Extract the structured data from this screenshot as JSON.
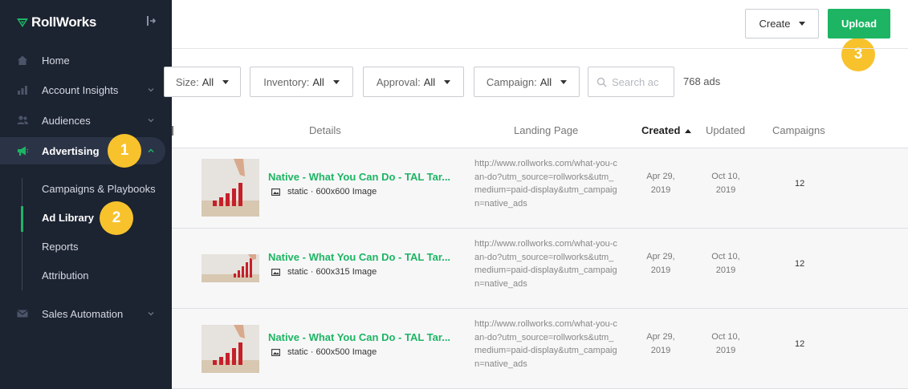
{
  "sidebar": {
    "logo_text": "RollWorks",
    "items": [
      {
        "label": "Home",
        "icon": "home-icon"
      },
      {
        "label": "Account Insights",
        "icon": "chart-icon"
      },
      {
        "label": "Audiences",
        "icon": "users-icon"
      },
      {
        "label": "Advertising",
        "icon": "megaphone-icon"
      },
      {
        "label": "Sales Automation",
        "icon": "mail-icon"
      }
    ],
    "sub_items": [
      "Campaigns & Playbooks",
      "Ad Library",
      "Reports",
      "Attribution"
    ]
  },
  "badges": [
    "1",
    "2",
    "3"
  ],
  "toolbar": {
    "create_label": "Create",
    "upload_label": "Upload"
  },
  "filters": {
    "size": {
      "label": "Size:",
      "value": "All"
    },
    "inventory": {
      "label": "Inventory:",
      "value": "All"
    },
    "approval": {
      "label": "Approval:",
      "value": "All"
    },
    "campaign": {
      "label": "Campaign:",
      "value": "All"
    },
    "search_placeholder": "Search ac",
    "count": "768 ads"
  },
  "table": {
    "headers": {
      "details": "Details",
      "landing": "Landing Page",
      "created": "Created",
      "updated": "Updated",
      "campaigns": "Campaigns"
    },
    "rows": [
      {
        "title": "Native - What You Can Do - TAL Tar...",
        "meta": "static · 600x600 Image",
        "landing": "http://www.rollworks.com/what-you-can-do?utm_source=rollworks&utm_medium=paid-display&utm_campaign=native_ads",
        "created_1": "Apr 29,",
        "created_2": "2019",
        "updated_1": "Oct 10,",
        "updated_2": "2019",
        "campaigns": "12"
      },
      {
        "title": "Native - What You Can Do - TAL Tar...",
        "meta": "static · 600x315 Image",
        "landing": "http://www.rollworks.com/what-you-can-do?utm_source=rollworks&utm_medium=paid-display&utm_campaign=native_ads",
        "created_1": "Apr 29,",
        "created_2": "2019",
        "updated_1": "Oct 10,",
        "updated_2": "2019",
        "campaigns": "12"
      },
      {
        "title": "Native - What You Can Do - TAL Tar...",
        "meta": "static · 600x500 Image",
        "landing": "http://www.rollworks.com/what-you-can-do?utm_source=rollworks&utm_medium=paid-display&utm_campaign=native_ads",
        "created_1": "Apr 29,",
        "created_2": "2019",
        "updated_1": "Oct 10,",
        "updated_2": "2019",
        "campaigns": "12"
      }
    ]
  },
  "colors": {
    "sidebar_bg": "#1c2331",
    "accent_green": "#1db563",
    "badge_yellow": "#f7c22c"
  }
}
